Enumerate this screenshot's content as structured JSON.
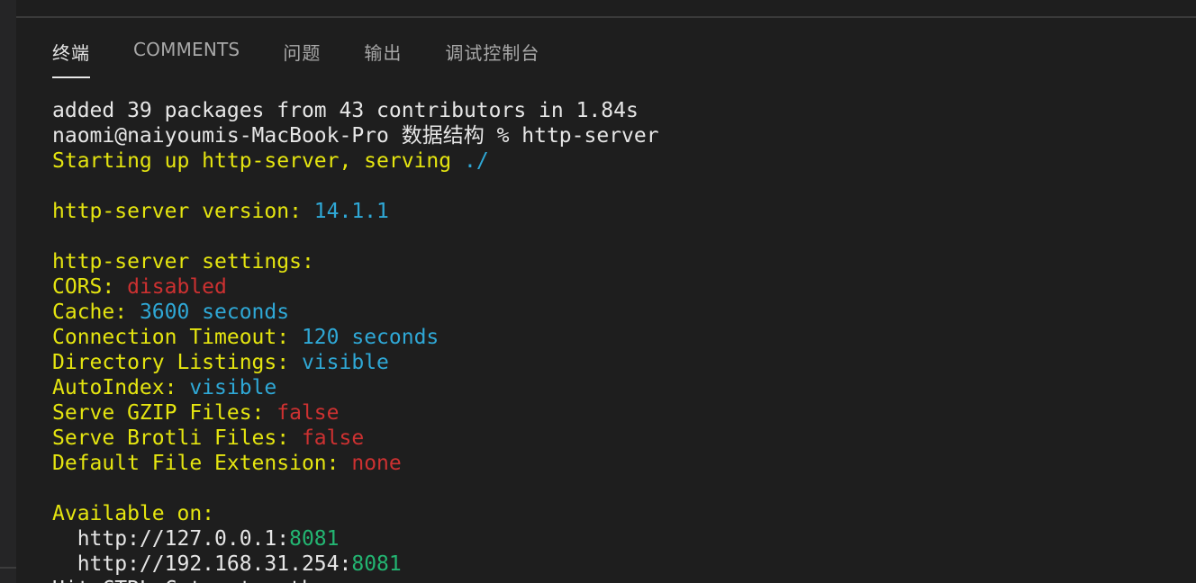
{
  "panel": {
    "tabs": [
      {
        "label": "终端",
        "active": true
      },
      {
        "label": "COMMENTS",
        "active": false
      },
      {
        "label": "问题",
        "active": false
      },
      {
        "label": "输出",
        "active": false
      },
      {
        "label": "调试控制台",
        "active": false
      }
    ]
  },
  "colors": {
    "background": "#1e1e1e",
    "default_text": "#e6e6e6",
    "yellow": "#e5e510",
    "cyan": "#2fa8d6",
    "red": "#cd3131",
    "green": "#23b572",
    "tab_inactive": "#a8a8a8",
    "tab_active": "#e7e7e7"
  },
  "terminal": {
    "lines": [
      {
        "segments": [
          {
            "text": "added 39 packages from 43 contributors in 1.84s",
            "color": "w"
          }
        ]
      },
      {
        "segments": [
          {
            "text": "naomi@naiyoumis-MacBook-Pro 数据结构 % http-server",
            "color": "w"
          }
        ]
      },
      {
        "segments": [
          {
            "text": "Starting up http-server, serving ",
            "color": "y"
          },
          {
            "text": "./",
            "color": "c"
          }
        ]
      },
      {
        "segments": []
      },
      {
        "segments": [
          {
            "text": "http-server version: ",
            "color": "y"
          },
          {
            "text": "14.1.1",
            "color": "c"
          }
        ]
      },
      {
        "segments": []
      },
      {
        "segments": [
          {
            "text": "http-server settings:",
            "color": "y"
          }
        ]
      },
      {
        "segments": [
          {
            "text": "CORS: ",
            "color": "y"
          },
          {
            "text": "disabled",
            "color": "r"
          }
        ]
      },
      {
        "segments": [
          {
            "text": "Cache: ",
            "color": "y"
          },
          {
            "text": "3600 seconds",
            "color": "c"
          }
        ]
      },
      {
        "segments": [
          {
            "text": "Connection Timeout: ",
            "color": "y"
          },
          {
            "text": "120 seconds",
            "color": "c"
          }
        ]
      },
      {
        "segments": [
          {
            "text": "Directory Listings: ",
            "color": "y"
          },
          {
            "text": "visible",
            "color": "c"
          }
        ]
      },
      {
        "segments": [
          {
            "text": "AutoIndex: ",
            "color": "y"
          },
          {
            "text": "visible",
            "color": "c"
          }
        ]
      },
      {
        "segments": [
          {
            "text": "Serve GZIP Files: ",
            "color": "y"
          },
          {
            "text": "false",
            "color": "r"
          }
        ]
      },
      {
        "segments": [
          {
            "text": "Serve Brotli Files: ",
            "color": "y"
          },
          {
            "text": "false",
            "color": "r"
          }
        ]
      },
      {
        "segments": [
          {
            "text": "Default File Extension: ",
            "color": "y"
          },
          {
            "text": "none",
            "color": "r"
          }
        ]
      },
      {
        "segments": []
      },
      {
        "segments": [
          {
            "text": "Available on:",
            "color": "y"
          }
        ]
      },
      {
        "segments": [
          {
            "text": "  http://127.0.0.1:",
            "color": "w"
          },
          {
            "text": "8081",
            "color": "g"
          }
        ]
      },
      {
        "segments": [
          {
            "text": "  http://192.168.31.254:",
            "color": "w"
          },
          {
            "text": "8081",
            "color": "g"
          }
        ]
      },
      {
        "segments": [
          {
            "text": "Hit CTRL-C to stop the server",
            "color": "w"
          }
        ]
      }
    ]
  }
}
